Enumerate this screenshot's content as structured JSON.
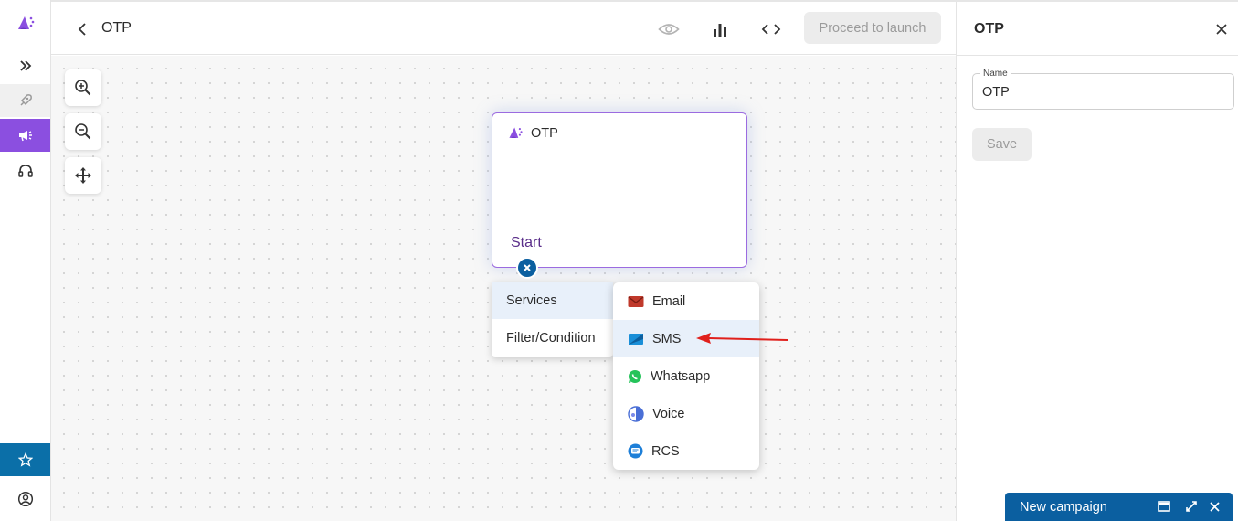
{
  "header": {
    "back_icon": "chevron-left-icon",
    "title": "OTP",
    "preview_icon": "eye-icon",
    "analytics_icon": "bar-chart-icon",
    "code_icon": "code-icon",
    "proceed_label": "Proceed to launch"
  },
  "sidebar": {
    "items": [
      {
        "icon": "megaphone-logo-icon"
      },
      {
        "icon": "double-chevron-right-icon"
      },
      {
        "icon": "rocket-icon"
      },
      {
        "icon": "megaphone-icon",
        "active": true
      },
      {
        "icon": "headset-icon"
      },
      {
        "icon": "star-icon"
      },
      {
        "icon": "user-circle-icon"
      }
    ],
    "active_color": "#8b4fe0",
    "star_color": "#0b6fa8"
  },
  "canvas": {
    "zoom_in_icon": "zoom-in-icon",
    "zoom_out_icon": "zoom-out-icon",
    "pan_icon": "move-icon",
    "node": {
      "title": "OTP",
      "start_label": "Start"
    },
    "menu": {
      "items": [
        "Services",
        "Filter/Condition"
      ]
    },
    "submenu": {
      "items": [
        {
          "label": "Email",
          "icon": "email-icon"
        },
        {
          "label": "SMS",
          "icon": "sms-icon"
        },
        {
          "label": "Whatsapp",
          "icon": "whatsapp-icon"
        },
        {
          "label": "Voice",
          "icon": "voice-icon"
        },
        {
          "label": "RCS",
          "icon": "rcs-icon"
        }
      ]
    }
  },
  "panel": {
    "title": "OTP",
    "name_label": "Name",
    "name_value": "OTP",
    "save_label": "Save"
  },
  "campaign_bar": {
    "label": "New campaign",
    "color": "#0b5fa0"
  }
}
